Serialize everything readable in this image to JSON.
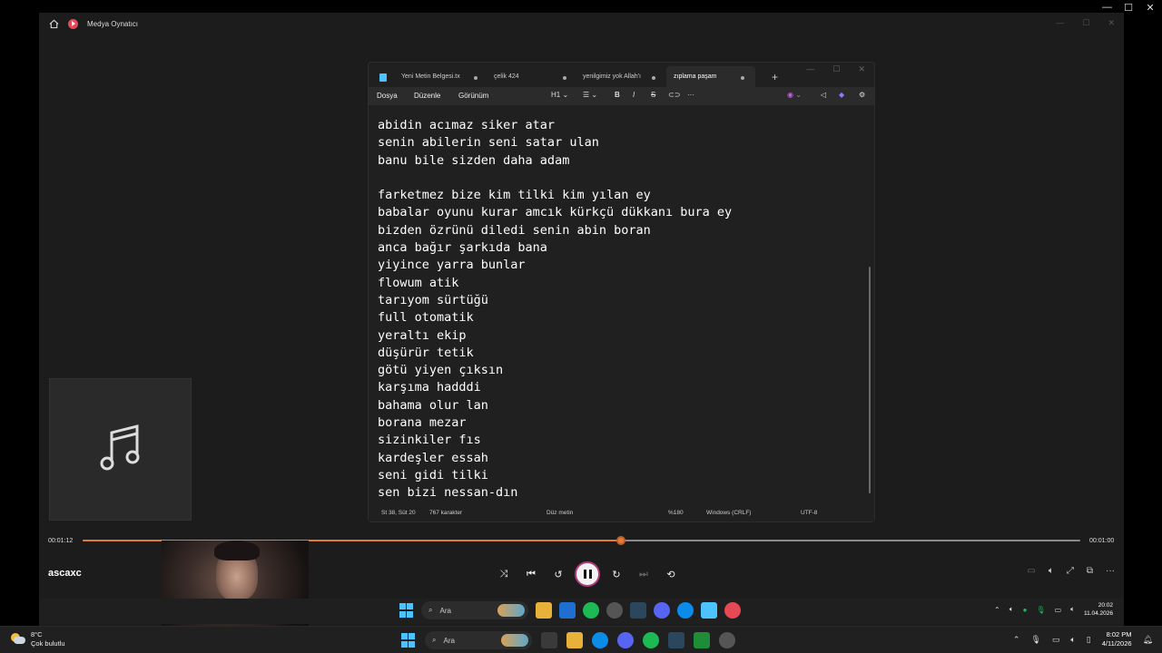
{
  "player": {
    "app_title": "Medya Oynatıcı",
    "song_title": "ascaxc",
    "time_elapsed": "00:01:12",
    "time_total": "00:01:00",
    "progress_fraction": 0.54,
    "accent_color": "#e07b39"
  },
  "notepad": {
    "tabs": [
      {
        "label": "Yeni Metin Belgesi.tx"
      },
      {
        "label": "çelik 424"
      },
      {
        "label": "yenilgimiz yok Allah'ı"
      },
      {
        "label": "zıplama paşam"
      }
    ],
    "menu": {
      "file": "Dosya",
      "edit": "Düzenle",
      "view": "Görünüm",
      "heading": "H1"
    },
    "lines": [
      "abidin acımaz siker atar",
      "senin abilerin seni satar ulan",
      "banu bile sizden daha adam",
      "",
      "farketmez bize kim tilki kim yılan ey",
      "babalar oyunu kurar amcık kürkçü dükkanı bura ey",
      "bizden özrünü diledi senin abin boran",
      "anca bağır şarkıda bana",
      "yiyince yarra bunlar",
      "flowum atik",
      "tarıyom sürtüğü",
      "full otomatik",
      "yeraltı ekip",
      "düşürür tetik",
      "götü yiyen çıksın",
      "karşıma hadddi",
      "bahama olur lan",
      "borana mezar",
      "sizinkiler fıs",
      "kardeşler essah",
      "seni gidi tilki",
      "sen bizi nessan-dın"
    ],
    "status": {
      "position": "St 38, Süt 20",
      "chars": "767 karakter",
      "format": "Düz metin",
      "zoom": "%180",
      "line_ending": "Windows (CRLF)",
      "encoding": "UTF-8"
    }
  },
  "inner_taskbar": {
    "search": "Ara",
    "time": "20:02",
    "date": "11.04.2026"
  },
  "taskbar": {
    "temp": "8°C",
    "weather": "Çok bulutlu",
    "search": "Ara",
    "time": "8:02 PM",
    "date": "4/11/2026"
  }
}
